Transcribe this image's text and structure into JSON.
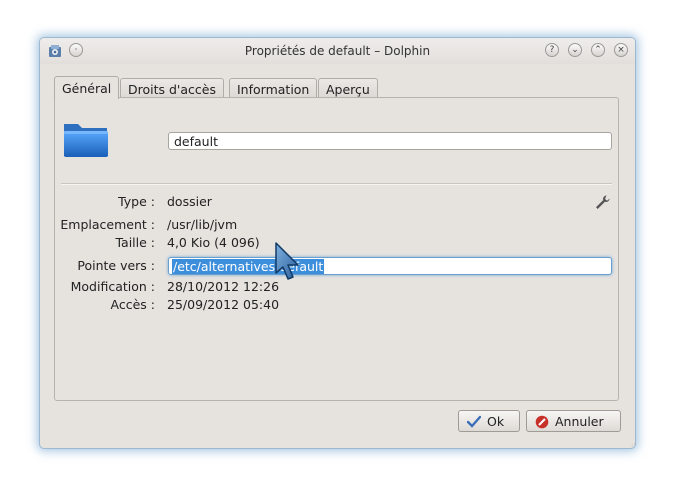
{
  "window": {
    "title": "Propriétés de default – Dolphin",
    "titlebar_buttons": [
      "help-icon",
      "minimize-icon",
      "maximize-icon",
      "close-icon"
    ]
  },
  "tabs": [
    {
      "label": "Général",
      "active": true
    },
    {
      "label": "Droits d'accès",
      "active": false
    },
    {
      "label": "Information",
      "active": false
    },
    {
      "label": "Aperçu",
      "active": false
    }
  ],
  "general": {
    "name_value": "default",
    "type_label": "Type :",
    "type_value": "dossier",
    "location_label": "Emplacement :",
    "location_value": "/usr/lib/jvm",
    "size_label": "Taille :",
    "size_value": "4,0 Kio (4 096)",
    "link_label": "Pointe vers :",
    "link_value": "/etc/alternatives/default",
    "modified_label": "Modification :",
    "modified_value": "28/10/2012 12:26",
    "accessed_label": "Accès :",
    "accessed_value": "25/09/2012 05:40"
  },
  "buttons": {
    "ok_label": "Ok",
    "cancel_label": "Annuler"
  },
  "colors": {
    "accent": "#3d8fdc",
    "window_bg": "#e6e3df",
    "folder_blue": "#2a77d4"
  }
}
